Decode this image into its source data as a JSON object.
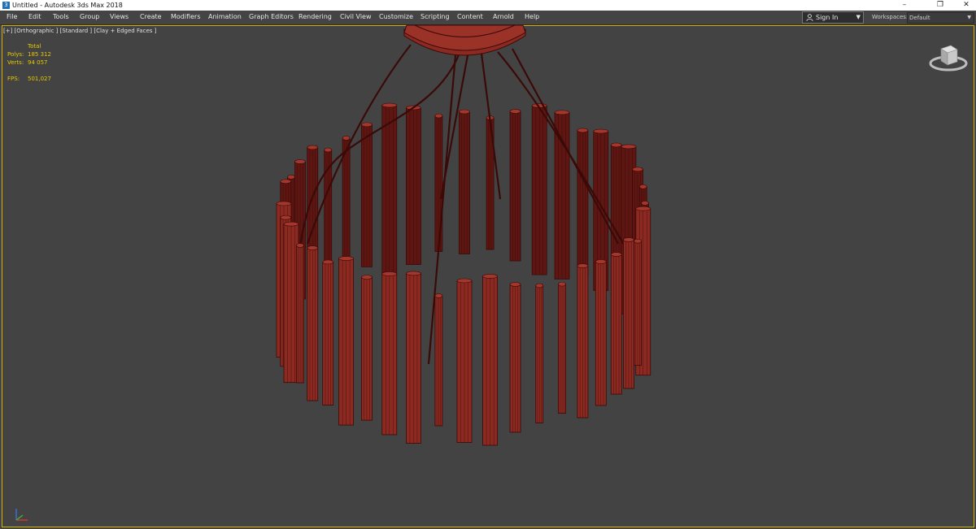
{
  "window": {
    "title": "Untitled - Autodesk 3ds Max 2018",
    "app_icon": "3ds-max-icon",
    "controls": [
      "minimize-icon",
      "restore-icon",
      "close-icon"
    ]
  },
  "menubar": {
    "items": [
      "File",
      "Edit",
      "Tools",
      "Group",
      "Views",
      "Create",
      "Modifiers",
      "Animation",
      "Graph Editors",
      "Rendering",
      "Civil View",
      "Customize",
      "Scripting",
      "Content",
      "Arnold",
      "Help"
    ]
  },
  "account": {
    "sign_in": "Sign In"
  },
  "workspaces": {
    "label": "Workspaces:",
    "value": "Default"
  },
  "viewport": {
    "label": "[+] [Orthographic ] [Standard ] [Clay + Edged Faces ]",
    "stats": {
      "header": "Total",
      "polys_label": "Polys:",
      "polys_value": "185 312",
      "verts_label": "Verts:",
      "verts_value": "94 057",
      "fps_label": "FPS:",
      "fps_value": "501,027"
    }
  },
  "colors": {
    "viewport_bg": "#434343",
    "active_border": "#d4b000",
    "stats_text": "#e8c800",
    "model_fill": "#8c2a22",
    "model_wire": "#3a0a08"
  }
}
